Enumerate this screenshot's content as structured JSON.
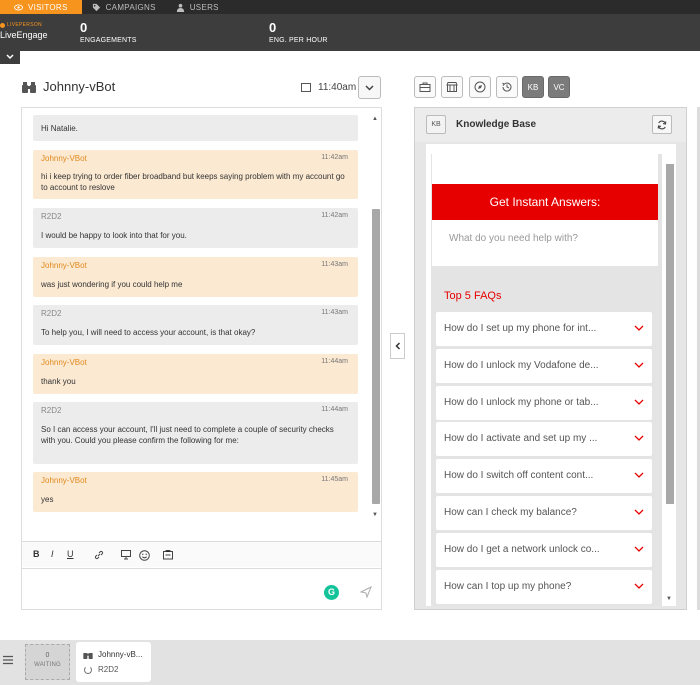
{
  "topnav": {
    "tabs": [
      {
        "label": "VISITORS",
        "icon": "eye-icon"
      },
      {
        "label": "CAMPAIGNS",
        "icon": "tag-icon"
      },
      {
        "label": "USERS",
        "icon": "user-icon"
      }
    ]
  },
  "stats": {
    "brand_small": "LIVEPERSON",
    "brand": "LiveEngage",
    "engagements_value": "0",
    "engagements_label": "ENGAGEMENTS",
    "eng_per_hour_value": "0",
    "eng_per_hour_label": "ENG. PER HOUR"
  },
  "conversation": {
    "title": "Johnny-vBot",
    "time": "11:40am",
    "messages": [
      {
        "type": "agent",
        "sender": "",
        "time": "",
        "text": "Hi Natalie."
      },
      {
        "type": "bot",
        "sender": "Johnny-VBot",
        "time": "11:42am",
        "text": "hi i keep trying to order fiber broadband but keeps saying problem with my account go to account to reslove"
      },
      {
        "type": "agent",
        "sender": "R2D2",
        "time": "11:42am",
        "text": "I would be happy to look into that for you."
      },
      {
        "type": "bot",
        "sender": "Johnny-VBot",
        "time": "11:43am",
        "text": "was just wondering if you could help me"
      },
      {
        "type": "agent",
        "sender": "R2D2",
        "time": "11:43am",
        "text": "To help you, I will need to access your account, is that okay?"
      },
      {
        "type": "bot",
        "sender": "Johnny-VBot",
        "time": "11:44am",
        "text": "thank you"
      },
      {
        "type": "agent",
        "sender": "R2D2",
        "time": "11:44am",
        "text": "So I can access your account, I'll just need to complete a couple of security checks with you. Could you please confirm the following for me:"
      },
      {
        "type": "bot",
        "sender": "Johnny-VBot",
        "time": "11:45am",
        "text": "yes"
      }
    ],
    "format": {
      "bold": "B",
      "italic": "I",
      "underline": "U"
    },
    "grammarly": "G"
  },
  "toolbar": {
    "kb": "KB",
    "vc": "VC"
  },
  "kb": {
    "badge": "KB",
    "title": "Knowledge Base",
    "banner": "Get Instant Answers:",
    "search_placeholder": "What do you need help with?",
    "faq_title": "Top 5 FAQs",
    "faqs": [
      "How do I set up my phone for int...",
      "How do I unlock my Vodafone de...",
      "How do I unlock my phone or tab...",
      "How do I activate and set up my ...",
      "How do I switch off content cont...",
      "How can I check my balance?",
      "How do I get a network unlock co...",
      "How can I top up my phone?"
    ]
  },
  "bottom": {
    "waiting_count": "0",
    "waiting_label": "WAITING",
    "card_name": "Johnny-vB...",
    "card_agent": "R2D2"
  },
  "colors": {
    "accent": "#f7941d",
    "bot_bubble": "#fbe9d2",
    "agent_bubble": "#ececec",
    "kb_red": "#e60000"
  }
}
